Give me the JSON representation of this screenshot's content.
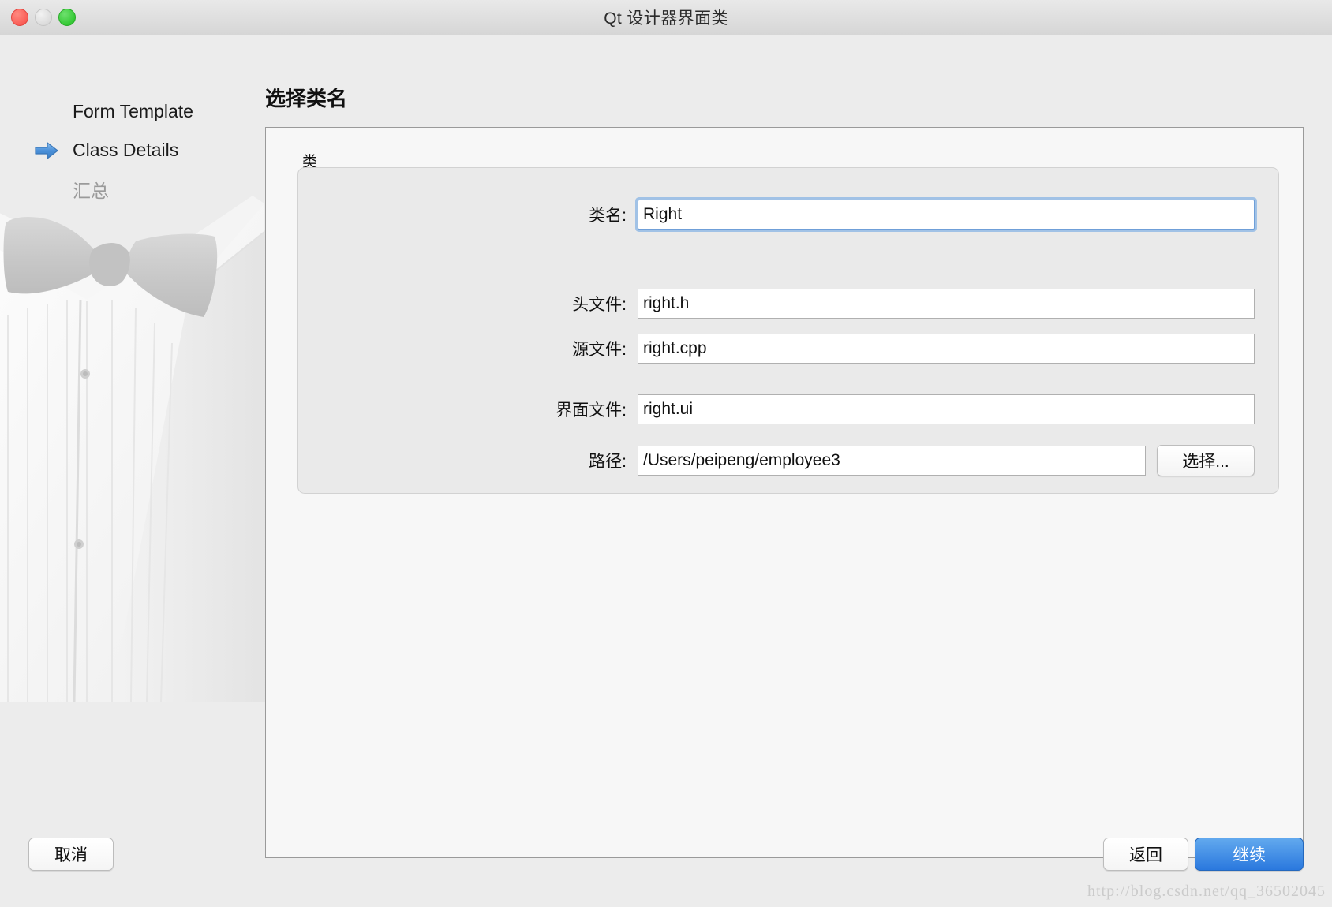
{
  "window": {
    "title": "Qt 设计器界面类",
    "traffic_lights": [
      {
        "name": "close",
        "color": "#fa5e57"
      },
      {
        "name": "minimize",
        "color": "#dcdcdc"
      },
      {
        "name": "zoom",
        "color": "#36c936"
      }
    ]
  },
  "sidebar": {
    "steps": [
      {
        "label": "Form Template",
        "state": "done",
        "has_arrow": false
      },
      {
        "label": "Class Details",
        "state": "current",
        "has_arrow": true,
        "arrow_icon": "right-arrow-icon",
        "arrow_color": "#4a90d9"
      },
      {
        "label": "汇总",
        "state": "upcoming",
        "has_arrow": false
      }
    ],
    "decoration_icon": "tuxedo-bowtie-artwork"
  },
  "main": {
    "heading": "选择类名",
    "group_label": "类",
    "fields": [
      {
        "label": "类名:",
        "value": "Right",
        "name": "class-name",
        "focused": true,
        "has_button": false
      },
      {
        "label": "头文件:",
        "value": "right.h",
        "name": "header-file",
        "focused": false,
        "has_button": false
      },
      {
        "label": "源文件:",
        "value": "right.cpp",
        "name": "source-file",
        "focused": false,
        "has_button": false
      },
      {
        "label": "界面文件:",
        "value": "right.ui",
        "name": "ui-file",
        "focused": false,
        "has_button": false
      },
      {
        "label": "路径:",
        "value": "/Users/peipeng/employee3",
        "name": "path",
        "focused": false,
        "has_button": true,
        "button_label": "选择..."
      }
    ],
    "choose_button_label": "选择..."
  },
  "footer": {
    "cancel_label": "取消",
    "back_label": "返回",
    "next_label": "继续",
    "next_accent_color": "#2a78de"
  },
  "watermark": {
    "text": "http://blog.csdn.net/qq_36502045"
  }
}
